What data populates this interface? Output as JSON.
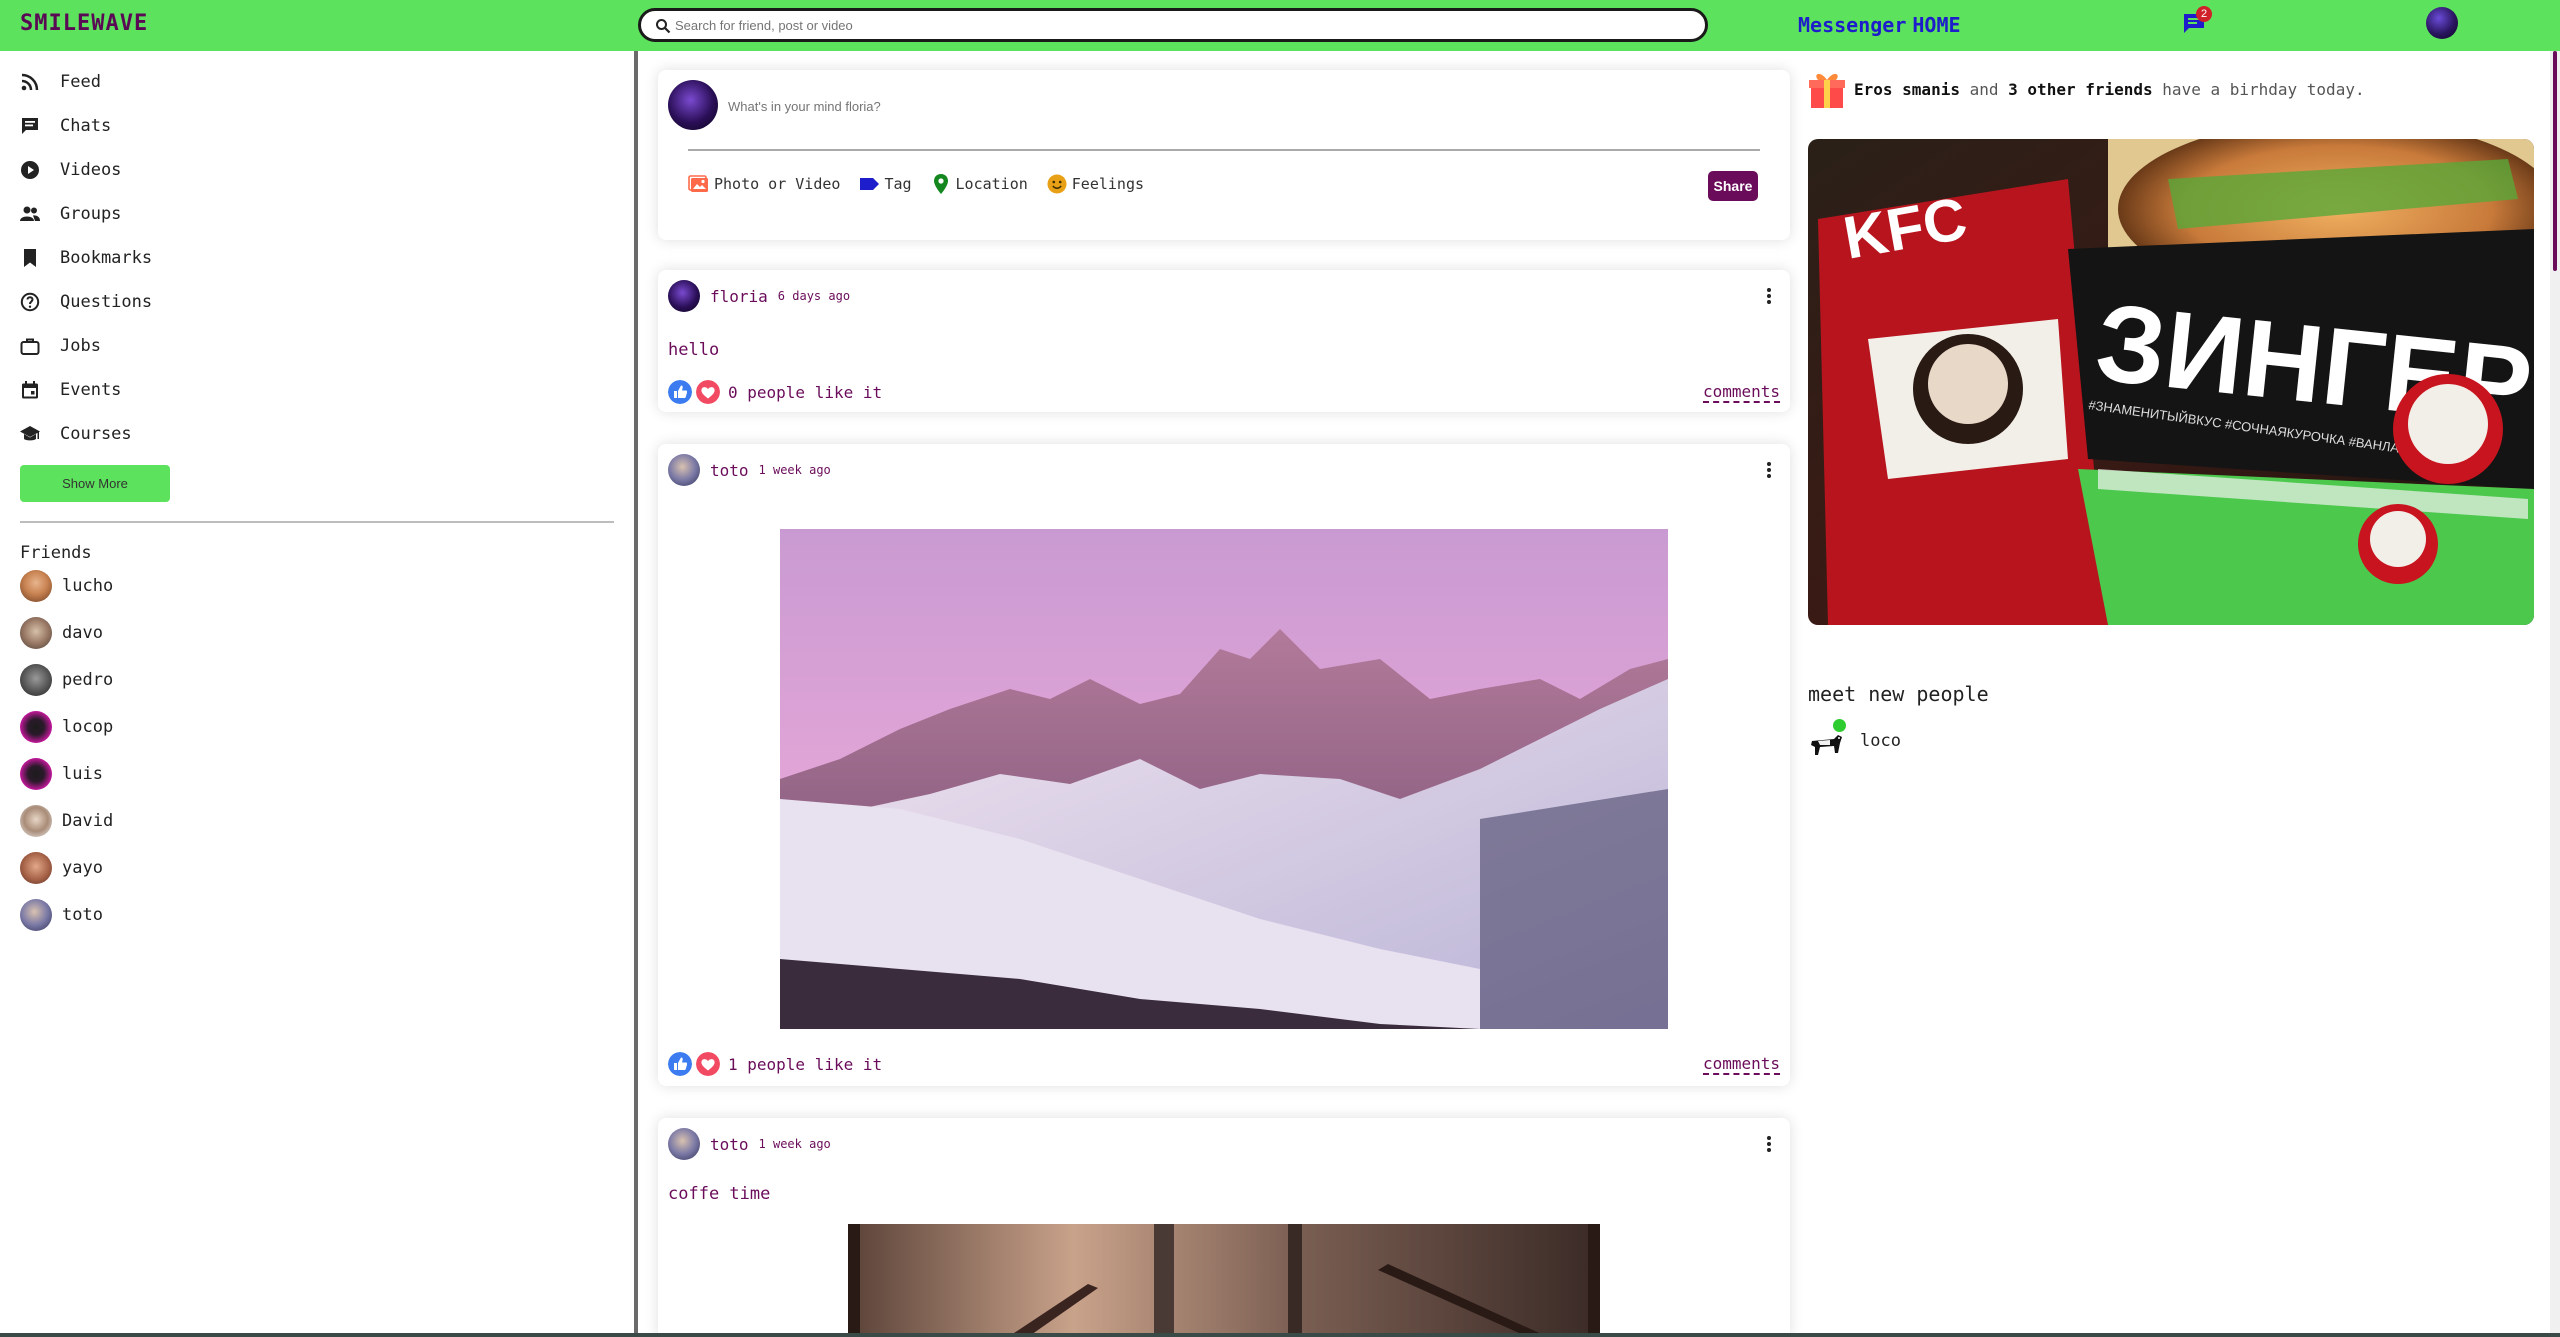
{
  "header": {
    "logo": "SMILEWAVE",
    "search_placeholder": "Search for friend, post or video",
    "nav_links": [
      "Messenger",
      "HOME"
    ],
    "message_badge": "2",
    "brand_color": "#5ce25c",
    "accent_color": "#6a0c5a"
  },
  "sidebar": {
    "items": [
      {
        "label": "Feed",
        "icon": "rss-icon"
      },
      {
        "label": "Chats",
        "icon": "chat-icon"
      },
      {
        "label": "Videos",
        "icon": "play-circle-icon"
      },
      {
        "label": "Groups",
        "icon": "groups-icon"
      },
      {
        "label": "Bookmarks",
        "icon": "bookmark-icon"
      },
      {
        "label": "Questions",
        "icon": "help-circle-icon"
      },
      {
        "label": "Jobs",
        "icon": "briefcase-icon"
      },
      {
        "label": "Events",
        "icon": "calendar-icon"
      },
      {
        "label": "Courses",
        "icon": "school-icon"
      }
    ],
    "show_more": "Show More",
    "friends_title": "Friends",
    "friends": [
      "lucho",
      "davo",
      "pedro",
      "locop",
      "luis",
      "David",
      "yayo",
      "toto"
    ]
  },
  "share": {
    "placeholder": "What's in your mind floria?",
    "options": [
      {
        "label": "Photo or Video",
        "icon": "photo-icon"
      },
      {
        "label": "Tag",
        "icon": "tag-icon"
      },
      {
        "label": "Location",
        "icon": "location-pin-icon"
      },
      {
        "label": "Feelings",
        "icon": "emoji-icon"
      }
    ],
    "button": "Share"
  },
  "posts": [
    {
      "user": "floria",
      "time": "6 days ago",
      "text": "hello",
      "likes": "0 people like it",
      "comments": "comments"
    },
    {
      "user": "toto",
      "time": "1 week ago",
      "text": "",
      "likes": "1 people like it",
      "comments": "comments"
    },
    {
      "user": "toto",
      "time": "1 week ago",
      "text": "coffe time"
    }
  ],
  "right": {
    "birthday": {
      "name": "Eros smanis",
      "and": "and",
      "others": "3 other friends",
      "rest": "have a birhday today."
    },
    "meet_title": "meet new people",
    "online": [
      {
        "name": "loco"
      }
    ]
  }
}
